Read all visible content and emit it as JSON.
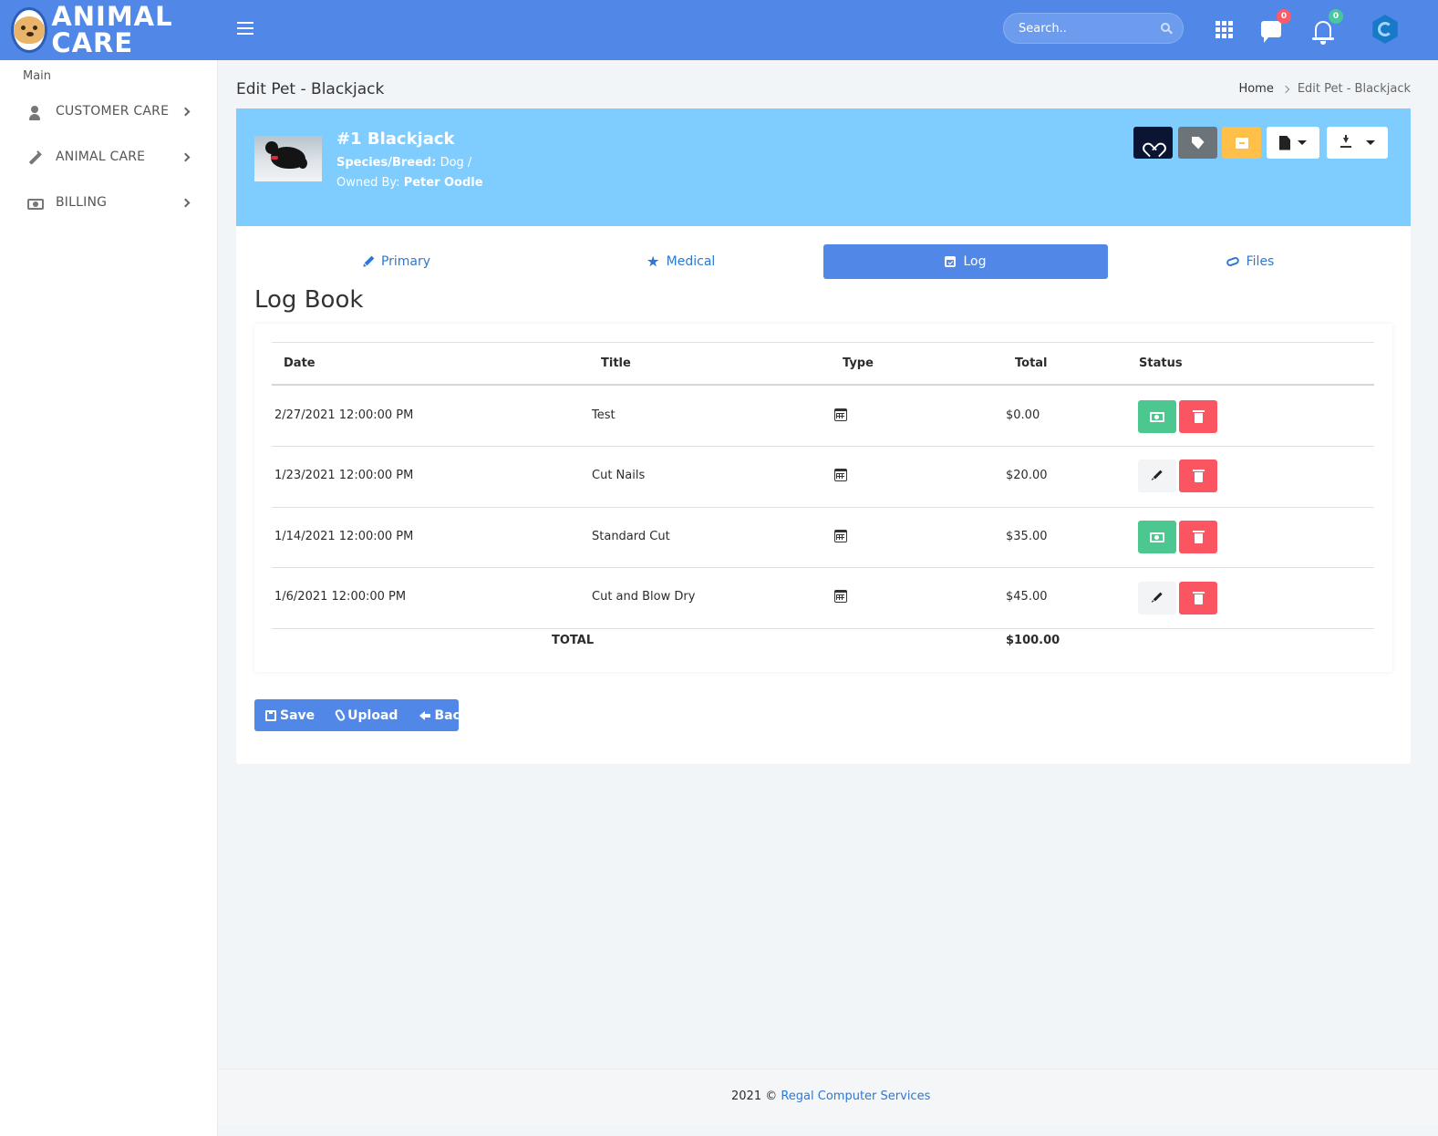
{
  "app": {
    "brand": "ANIMAL CARE",
    "search_placeholder": "Search..",
    "messages_count": "0",
    "notifications_count": "0"
  },
  "sidebar": {
    "section": "Main",
    "items": [
      {
        "label": "CUSTOMER CARE",
        "icon": "user-icon"
      },
      {
        "label": "ANIMAL CARE",
        "icon": "syringe-icon"
      },
      {
        "label": "BILLING",
        "icon": "money-bill-icon"
      }
    ]
  },
  "page": {
    "title": "Edit Pet - Blackjack",
    "breadcrumb": [
      "Home",
      "Edit Pet - Blackjack"
    ]
  },
  "pet": {
    "name": "#1 Blackjack",
    "species_label": "Species/Breed:",
    "species_value": "Dog /",
    "owner_label": "Owned By:",
    "owner_value": "Peter Oodle"
  },
  "tabs": [
    {
      "label": "Primary",
      "icon": "pencil-icon",
      "active": false
    },
    {
      "label": "Medical",
      "icon": "star-icon",
      "active": false
    },
    {
      "label": "Log",
      "icon": "calendar-check-icon",
      "active": true
    },
    {
      "label": "Files",
      "icon": "paperclip-icon",
      "active": false
    }
  ],
  "logbook": {
    "title": "Log Book",
    "columns": [
      "Date",
      "Title",
      "Type",
      "Total",
      "Status"
    ],
    "rows": [
      {
        "date": "2/27/2021 12:00:00 PM",
        "title": "Test",
        "type_icon": "calendar-icon",
        "total": "$0.00",
        "status": "paid"
      },
      {
        "date": "1/23/2021 12:00:00 PM",
        "title": "Cut Nails",
        "type_icon": "calendar-icon",
        "total": "$20.00",
        "status": "edit"
      },
      {
        "date": "1/14/2021 12:00:00 PM",
        "title": "Standard Cut",
        "type_icon": "calendar-icon",
        "total": "$35.00",
        "status": "paid"
      },
      {
        "date": "1/6/2021 12:00:00 PM",
        "title": "Cut and Blow Dry",
        "type_icon": "calendar-icon",
        "total": "$45.00",
        "status": "edit"
      }
    ],
    "total_label": "TOTAL",
    "total_value": "$100.00"
  },
  "actions": {
    "save": "Save",
    "upload": "Upload",
    "back": "Back"
  },
  "footer": {
    "copyright": "2021 ©",
    "company": "Regal Computer Services"
  },
  "colors": {
    "primary": "#5188e8",
    "header_band": "#7fccff",
    "success": "#4cc790",
    "danger": "#fb5562",
    "warning": "#ffc04a",
    "dark": "#0b1533"
  }
}
